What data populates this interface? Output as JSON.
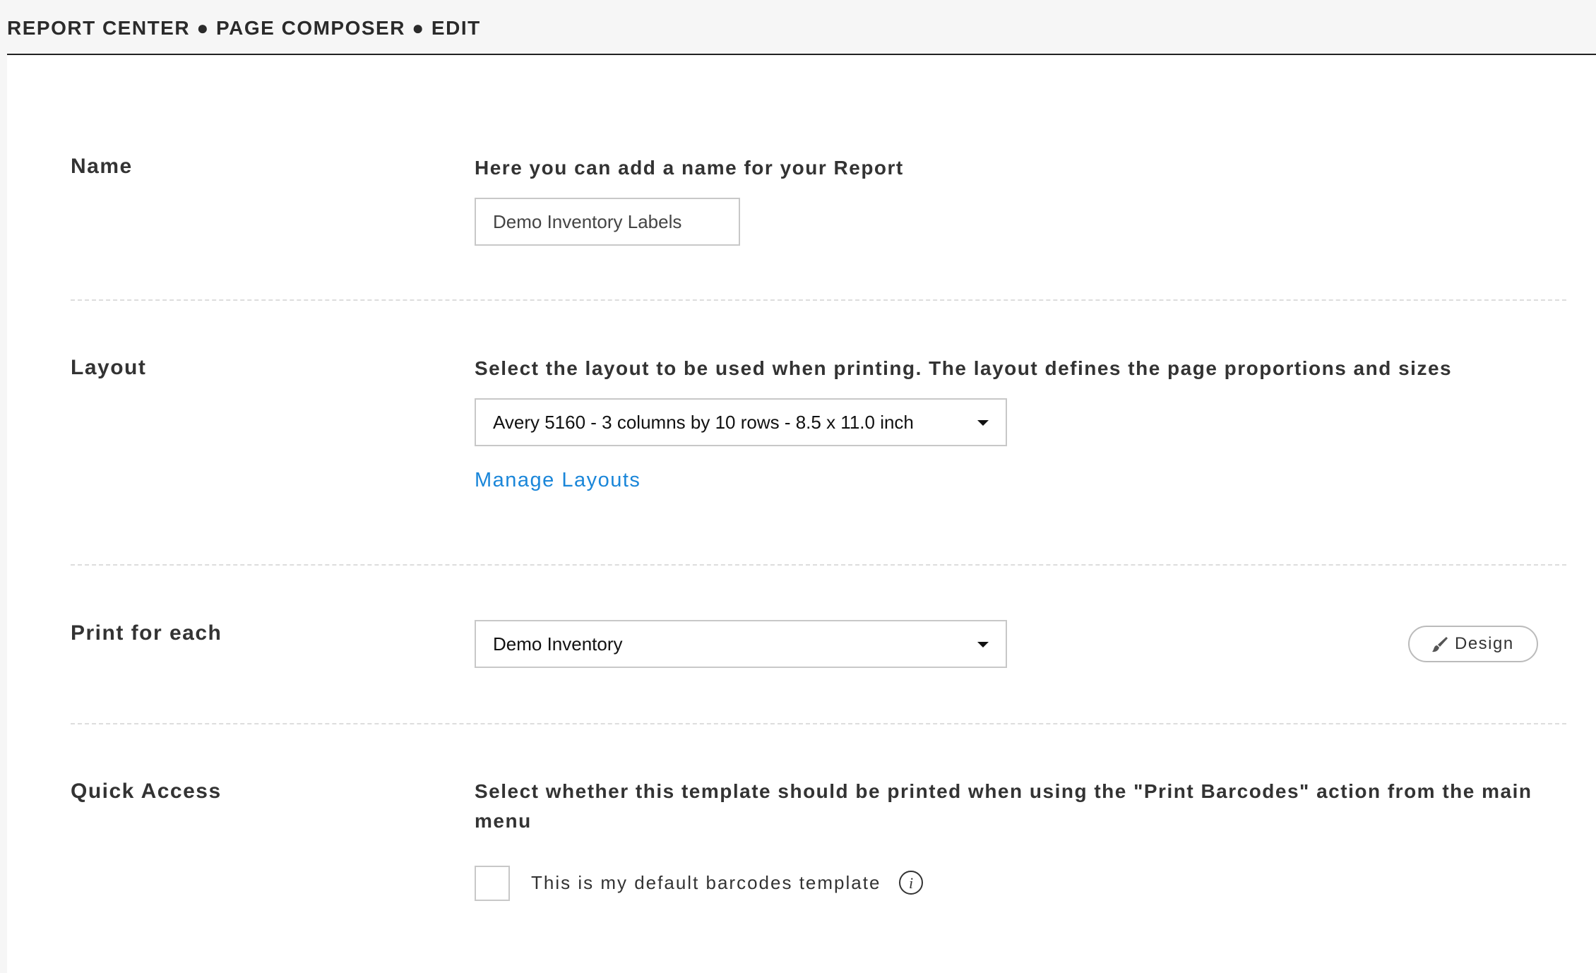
{
  "header": {
    "breadcrumb": "REPORT CENTER ● PAGE COMPOSER ● EDIT"
  },
  "name_section": {
    "label": "Name",
    "description": "Here you can add a name for your Report",
    "value": "Demo Inventory Labels"
  },
  "layout_section": {
    "label": "Layout",
    "description": "Select the layout to be used when printing. The layout defines the page proportions and sizes",
    "selected": "Avery 5160 - 3 columns by 10 rows - 8.5 x 11.0 inch",
    "manage_link": "Manage Layouts"
  },
  "print_section": {
    "label": "Print for each",
    "selected": "Demo Inventory",
    "design_button": "Design"
  },
  "quick_access_section": {
    "label": "Quick Access",
    "description": "Select whether this template should be printed when using the \"Print Barcodes\" action from the main menu",
    "checkbox_label": "This is my default barcodes template",
    "checked": false
  },
  "icons": {
    "dropdown": "caret-down-icon",
    "design": "paint-brush-icon",
    "info": "info-icon"
  },
  "colors": {
    "link": "#1a86d9",
    "divider": "#dddddd",
    "header_bg": "#f6f6f6"
  }
}
